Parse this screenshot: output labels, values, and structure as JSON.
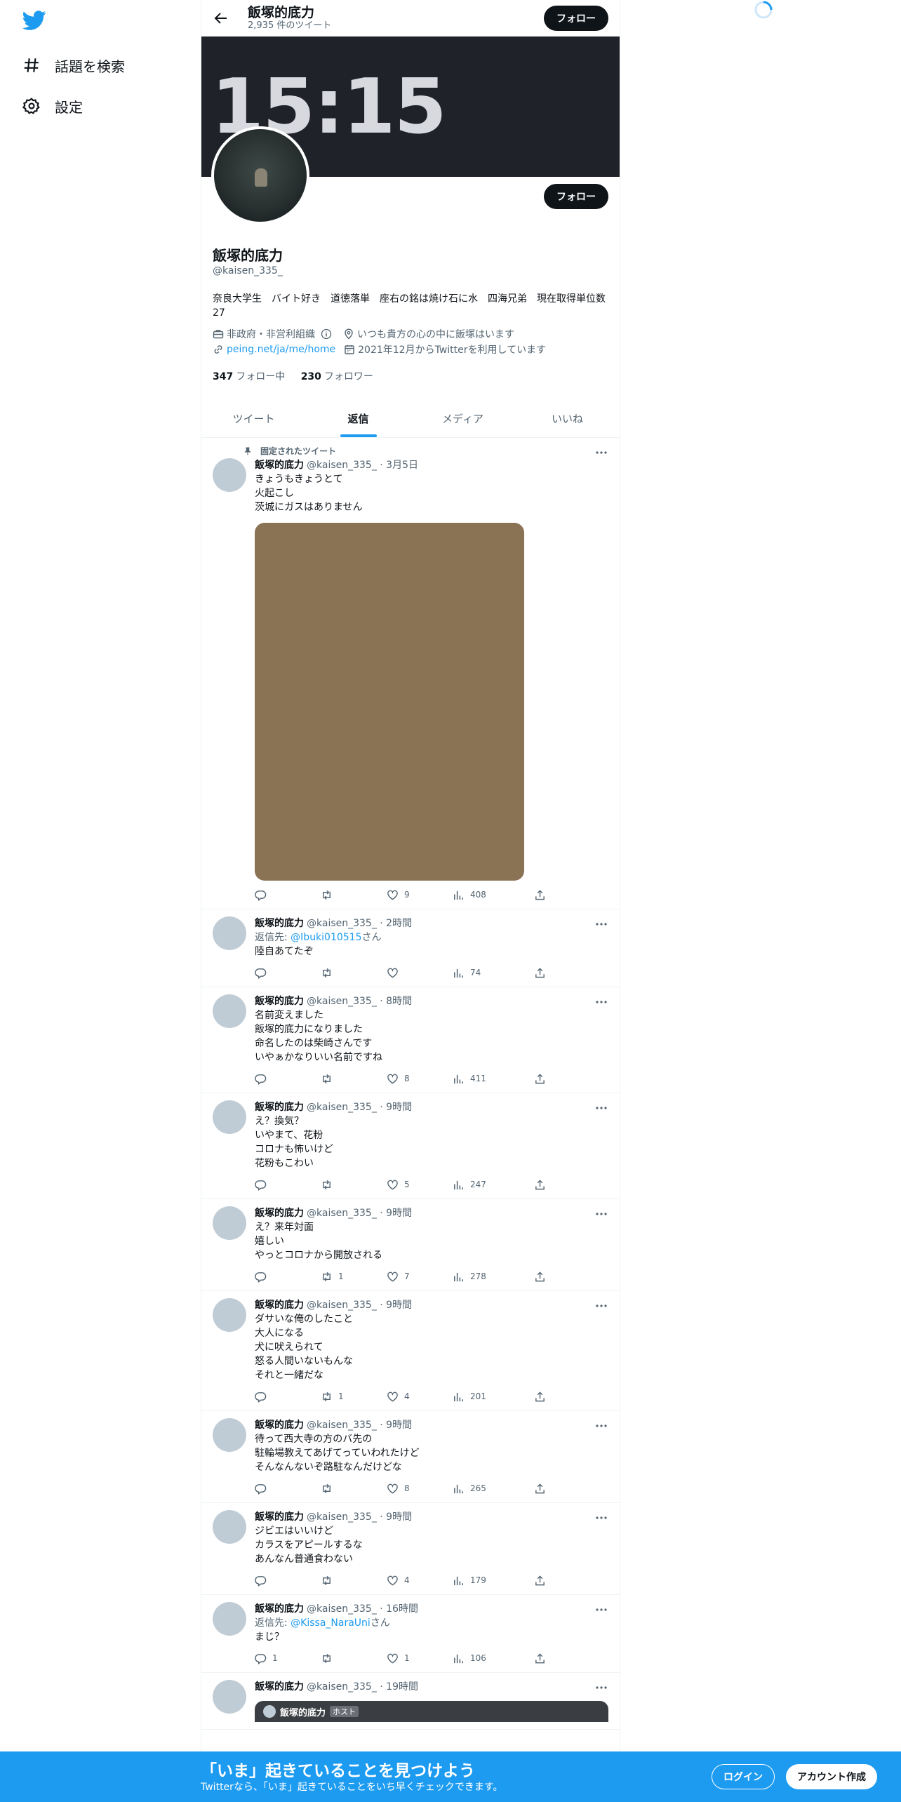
{
  "nav": {
    "logo_icon": "twitter-bird-icon",
    "items": [
      {
        "icon": "hashtag-icon",
        "label": "話題を検索"
      },
      {
        "icon": "gear-icon",
        "label": "設定"
      }
    ]
  },
  "header": {
    "name": "飯塚的底力",
    "tweet_count": "2,935 件のツイート",
    "follow_label": "フォロー"
  },
  "banner": {
    "text": "15:15"
  },
  "profile": {
    "follow_label": "フォロー",
    "name": "飯塚的底力",
    "handle": "@kaisen_335_",
    "bio": "奈良大学生　バイト好き　道徳落単　座右の銘は焼け石に水　四海兄弟　現在取得単位数27",
    "category": "非政府・非営利組織",
    "location": "いつも貴方の心の中に飯塚はいます",
    "link": "peing.net/ja/me/home",
    "joined": "2021年12月からTwitterを利用しています",
    "following_count": "347",
    "following_label": "フォロー中",
    "followers_count": "230",
    "followers_label": "フォロワー"
  },
  "tabs": [
    "ツイート",
    "返信",
    "メディア",
    "いいね"
  ],
  "active_tab": "返信",
  "pinned_label": "固定されたツイート",
  "tweets": [
    {
      "name": "飯塚的底力",
      "meta": "@kaisen_335_ · 3月5日",
      "reply_to": "",
      "text": "きょうもきょうとて\n火起こし\n茨城にガスはありません",
      "has_media": true,
      "replies": "",
      "retweets": "",
      "likes": "9",
      "views": "408"
    },
    {
      "name": "飯塚的底力",
      "meta": "@kaisen_335_ · 2時間",
      "reply_prefix": "返信先: ",
      "reply_to": "@Ibuki010515",
      "reply_suffix": "さん",
      "text": "陸自あてたぞ",
      "replies": "",
      "retweets": "",
      "likes": "",
      "views": "74"
    },
    {
      "name": "飯塚的底力",
      "meta": "@kaisen_335_ · 8時間",
      "reply_to": "",
      "text": "名前変えました\n飯塚的底力になりました\n命名したのは柴崎さんです\nいやぁかなりいい名前ですね",
      "replies": "",
      "retweets": "",
      "likes": "8",
      "views": "411"
    },
    {
      "name": "飯塚的底力",
      "meta": "@kaisen_335_ · 9時間",
      "reply_to": "",
      "text": "え？換気？\nいやまて、花粉\nコロナも怖いけど\n花粉もこわい",
      "replies": "",
      "retweets": "",
      "likes": "5",
      "views": "247"
    },
    {
      "name": "飯塚的底力",
      "meta": "@kaisen_335_ · 9時間",
      "reply_to": "",
      "text": "え？来年対面\n嬉しい\nやっとコロナから開放される",
      "replies": "",
      "retweets": "1",
      "likes": "7",
      "views": "278"
    },
    {
      "name": "飯塚的底力",
      "meta": "@kaisen_335_ · 9時間",
      "reply_to": "",
      "text": "ダサいな俺のしたこと\n大人になる\n犬に吠えられて\n怒る人間いないもんな\nそれと一緒だな",
      "replies": "",
      "retweets": "1",
      "likes": "4",
      "views": "201"
    },
    {
      "name": "飯塚的底力",
      "meta": "@kaisen_335_ · 9時間",
      "reply_to": "",
      "text": "待って西大寺の方のバ先の\n駐輪場教えてあげてっていわれたけど\nそんなんないぞ路駐なんだけどな",
      "replies": "",
      "retweets": "",
      "likes": "8",
      "views": "265"
    },
    {
      "name": "飯塚的底力",
      "meta": "@kaisen_335_ · 9時間",
      "reply_to": "",
      "text": "ジビエはいいけど\nカラスをアピールするな\nあんなん普通食わない",
      "replies": "",
      "retweets": "",
      "likes": "4",
      "views": "179"
    },
    {
      "name": "飯塚的底力",
      "meta": "@kaisen_335_ · 16時間",
      "reply_prefix": "返信先: ",
      "reply_to": "@Kissa_NaraUni",
      "reply_suffix": "さん",
      "text": "まじ？",
      "replies": "1",
      "retweets": "",
      "likes": "1",
      "views": "106"
    },
    {
      "name": "飯塚的底力",
      "meta": "@kaisen_335_ · 19時間",
      "reply_to": "",
      "text": "",
      "quote_name": "飯塚的底力",
      "quote_badge": "ホスト",
      "replies": "",
      "retweets": "",
      "likes": "",
      "views": ""
    }
  ],
  "bottom_banner": {
    "title": "「いま」起きていることを見つけよう",
    "subtitle": "Twitterなら、「いま」起きていることをいち早くチェックできます。",
    "login_label": "ログイン",
    "signup_label": "アカウント作成"
  }
}
